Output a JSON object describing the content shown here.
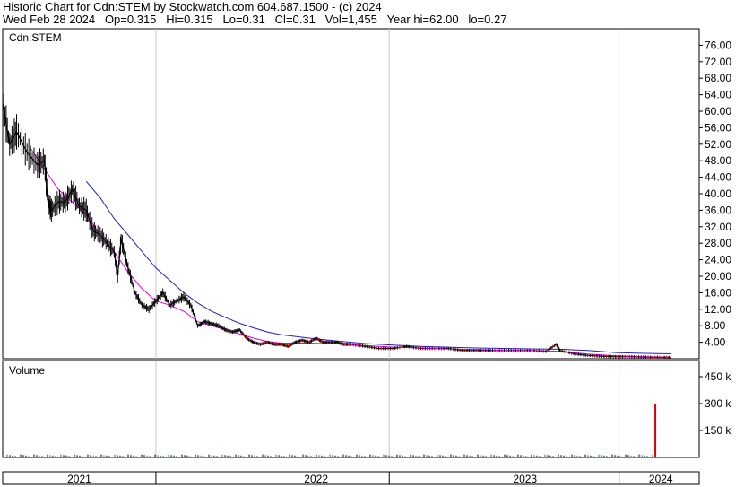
{
  "header": {
    "line1": "Historic Chart for Cdn:STEM by Stockwatch.com 604.687.1500 - (c) 2024",
    "line2": "Wed Feb 28 2024   Op=0.315   Hi=0.315   Lo=0.31   Cl=0.31   Vol=1,455   Year hi=62.00   lo=0.27"
  },
  "price_panel": {
    "label": "Cdn:STEM"
  },
  "volume_panel": {
    "label": "Volume"
  },
  "colors": {
    "price": "#000000",
    "ma_short": "#e000e0",
    "ma_long": "#2020c0",
    "down_tick": "#cc0000",
    "volume_spike": "#dd0000",
    "volume_base": "#000000",
    "grid": "#c8c8c8"
  },
  "chart_data": [
    {
      "type": "line",
      "title": "Cdn:STEM",
      "ylim": [
        0,
        80
      ],
      "ytick_labels": [
        "76.00",
        "72.00",
        "68.00",
        "64.00",
        "60.00",
        "56.00",
        "52.00",
        "48.00",
        "44.00",
        "40.00",
        "36.00",
        "32.00",
        "28.00",
        "24.00",
        "20.00",
        "16.00",
        "12.00",
        "8.00",
        "4.00"
      ],
      "ytick_values": [
        76,
        72,
        68,
        64,
        60,
        56,
        52,
        48,
        44,
        40,
        36,
        32,
        28,
        24,
        20,
        16,
        12,
        8,
        4
      ],
      "x_labels": [
        "2021",
        "2022",
        "2023",
        "2024"
      ],
      "x_label_t": [
        0.11,
        0.45,
        0.75,
        0.945
      ],
      "year_boundaries_t": [
        0.22,
        0.555,
        0.885
      ],
      "series": [
        {
          "role": "price",
          "points": [
            [
              0.0,
              62
            ],
            [
              0.01,
              52
            ],
            [
              0.02,
              55
            ],
            [
              0.035,
              50
            ],
            [
              0.05,
              47
            ],
            [
              0.06,
              48
            ],
            [
              0.065,
              38
            ],
            [
              0.07,
              36
            ],
            [
              0.08,
              38
            ],
            [
              0.09,
              38
            ],
            [
              0.1,
              41
            ],
            [
              0.11,
              37
            ],
            [
              0.12,
              36
            ],
            [
              0.13,
              31
            ],
            [
              0.14,
              30
            ],
            [
              0.15,
              28
            ],
            [
              0.16,
              26
            ],
            [
              0.165,
              20
            ],
            [
              0.17,
              29
            ],
            [
              0.18,
              22
            ],
            [
              0.19,
              16
            ],
            [
              0.2,
              13
            ],
            [
              0.21,
              12
            ],
            [
              0.22,
              14
            ],
            [
              0.23,
              16
            ],
            [
              0.24,
              13
            ],
            [
              0.25,
              14
            ],
            [
              0.26,
              15
            ],
            [
              0.27,
              13
            ],
            [
              0.28,
              8
            ],
            [
              0.29,
              9
            ],
            [
              0.3,
              8.5
            ],
            [
              0.31,
              8
            ],
            [
              0.32,
              7
            ],
            [
              0.33,
              6.5
            ],
            [
              0.34,
              7
            ],
            [
              0.35,
              5
            ],
            [
              0.36,
              4
            ],
            [
              0.37,
              3.5
            ],
            [
              0.38,
              4
            ],
            [
              0.39,
              3.5
            ],
            [
              0.4,
              3.5
            ],
            [
              0.41,
              3
            ],
            [
              0.42,
              4
            ],
            [
              0.43,
              4.5
            ],
            [
              0.44,
              4
            ],
            [
              0.45,
              5
            ],
            [
              0.46,
              4
            ],
            [
              0.47,
              4
            ],
            [
              0.48,
              4
            ],
            [
              0.49,
              3.5
            ],
            [
              0.5,
              3.5
            ],
            [
              0.52,
              3
            ],
            [
              0.54,
              2.5
            ],
            [
              0.56,
              2.5
            ],
            [
              0.58,
              3
            ],
            [
              0.6,
              2.5
            ],
            [
              0.62,
              2.5
            ],
            [
              0.64,
              2.5
            ],
            [
              0.66,
              2
            ],
            [
              0.68,
              2
            ],
            [
              0.7,
              2
            ],
            [
              0.72,
              2
            ],
            [
              0.74,
              2
            ],
            [
              0.76,
              2
            ],
            [
              0.78,
              1.8
            ],
            [
              0.795,
              3.5
            ],
            [
              0.8,
              2
            ],
            [
              0.82,
              1.2
            ],
            [
              0.84,
              0.8
            ],
            [
              0.86,
              0.6
            ],
            [
              0.88,
              0.5
            ],
            [
              0.9,
              0.5
            ],
            [
              0.92,
              0.4
            ],
            [
              0.94,
              0.35
            ],
            [
              0.96,
              0.31
            ]
          ]
        },
        {
          "role": "ma_short",
          "points": [
            [
              0.04,
              51
            ],
            [
              0.06,
              46
            ],
            [
              0.08,
              41
            ],
            [
              0.1,
              38
            ],
            [
              0.12,
              35
            ],
            [
              0.14,
              30
            ],
            [
              0.16,
              26
            ],
            [
              0.18,
              21
            ],
            [
              0.2,
              17
            ],
            [
              0.22,
              14
            ],
            [
              0.24,
              13
            ],
            [
              0.26,
              11.5
            ],
            [
              0.28,
              9
            ],
            [
              0.3,
              8
            ],
            [
              0.32,
              7
            ],
            [
              0.34,
              6
            ],
            [
              0.36,
              5
            ],
            [
              0.38,
              4.2
            ],
            [
              0.4,
              3.8
            ],
            [
              0.44,
              3.8
            ],
            [
              0.48,
              3.6
            ],
            [
              0.52,
              3.2
            ],
            [
              0.56,
              2.8
            ],
            [
              0.6,
              2.6
            ],
            [
              0.64,
              2.4
            ],
            [
              0.68,
              2.2
            ],
            [
              0.72,
              2
            ],
            [
              0.76,
              2
            ],
            [
              0.8,
              1.8
            ],
            [
              0.84,
              1.1
            ],
            [
              0.88,
              0.7
            ],
            [
              0.92,
              0.5
            ],
            [
              0.96,
              0.4
            ]
          ]
        },
        {
          "role": "ma_long",
          "points": [
            [
              0.12,
              43
            ],
            [
              0.14,
              39
            ],
            [
              0.16,
              34
            ],
            [
              0.18,
              30
            ],
            [
              0.2,
              26
            ],
            [
              0.22,
              22
            ],
            [
              0.24,
              19
            ],
            [
              0.26,
              16
            ],
            [
              0.28,
              13.5
            ],
            [
              0.3,
              11.5
            ],
            [
              0.32,
              10
            ],
            [
              0.34,
              8.6
            ],
            [
              0.36,
              7.5
            ],
            [
              0.38,
              6.5
            ],
            [
              0.4,
              5.8
            ],
            [
              0.44,
              5
            ],
            [
              0.48,
              4.3
            ],
            [
              0.52,
              3.7
            ],
            [
              0.56,
              3.3
            ],
            [
              0.6,
              3
            ],
            [
              0.64,
              2.8
            ],
            [
              0.68,
              2.6
            ],
            [
              0.72,
              2.5
            ],
            [
              0.76,
              2.4
            ],
            [
              0.8,
              2.3
            ],
            [
              0.84,
              2
            ],
            [
              0.88,
              1.5
            ],
            [
              0.92,
              1.3
            ],
            [
              0.96,
              1.2
            ]
          ]
        }
      ]
    },
    {
      "type": "bar",
      "title": "Volume",
      "ylim": [
        0,
        540
      ],
      "ytick_labels": [
        "450 k",
        "300 k",
        "150 k"
      ],
      "ytick_values": [
        450,
        300,
        150
      ],
      "spike": {
        "t": 0.937,
        "value": 300
      }
    }
  ]
}
